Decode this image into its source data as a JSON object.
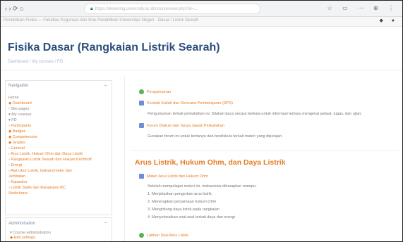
{
  "browser": {
    "nav_glyphs": "‹ › ⟳ ⌂",
    "url": "https://elearning.university.ac.id/course/view.php?id=...",
    "actions": "☆ ▭ ⋯ ⊕ ⋮"
  },
  "sitebar": {
    "crumb": "Pendidikan Fisika — Fakultas Keguruan dan Ilmu Pendidikan Universitas Negeri · Dasar / Listrik Searah",
    "user": "◆ ●"
  },
  "page": {
    "title": "Fisika Dasar (Rangkaian Listrik Searah)",
    "breadcrumb": "Dashboard / My courses / FD"
  },
  "sidebar": {
    "header": "Navigation",
    "collapse": "–",
    "items": [
      {
        "text": "Home",
        "orange": false
      },
      {
        "text": "◆ Dashboard",
        "orange": true
      },
      {
        "text": "› Site pages",
        "orange": false
      },
      {
        "text": "▾ My courses",
        "orange": false
      },
      {
        "text": "  ▾ FD",
        "orange": false
      },
      {
        "text": "    › Participants",
        "orange": true
      },
      {
        "text": "    ◆ Badges",
        "orange": true
      },
      {
        "text": "    ◆ Competencies",
        "orange": true
      },
      {
        "text": "    ◆ Grades",
        "orange": true
      },
      {
        "text": "    › General",
        "orange": true
      },
      {
        "text": "    › Arus Listrik, Hukum Ohm dan Daya Listrik",
        "orange": true
      },
      {
        "text": "    › Rangkaian Listrik Searah dan Hukum Kirchhoff",
        "orange": true
      },
      {
        "text": "    › Energi",
        "orange": true
      },
      {
        "text": "    › Alat Ukur Listrik, Galvanometer dan",
        "orange": true
      },
      {
        "text": "      Jembatan",
        "orange": true
      },
      {
        "text": "    › Kapasitor",
        "orange": true
      },
      {
        "text": "    › Listrik Statis dan Rangkaian RC",
        "orange": true
      },
      {
        "text": "      Sederhana",
        "orange": true
      }
    ]
  },
  "sidebar2": {
    "header": "Administration",
    "collapse": "–",
    "items": [
      "▾ Course administration",
      "  ◆ Edit settings"
    ]
  },
  "main": {
    "activities_top": [
      {
        "icon": "green",
        "text": "Pengumuman"
      },
      {
        "icon": "blue",
        "text": "Kontrak Kuliah dan Rencana Pembelajaran (RPS)"
      }
    ],
    "desc1": "Pengumuman terkait perkuliahan ini. Silakan baca secara berkala untuk informasi terbaru mengenai jadwal, tugas, dan ujian.",
    "activity3": "Forum Diskusi dan Tanya Jawab Perkuliahan",
    "desc2": "Gunakan forum ini untuk bertanya dan berdiskusi terkait materi yang dipelajari.",
    "section_title": "Arus Listrik, Hukum Ohm, dan Daya Listrik",
    "section_activity": "Materi Arus Listrik dan Hukum Ohm",
    "objectives_intro": "Setelah mempelajari materi ini, mahasiswa diharapkan mampu:",
    "objectives": [
      "1. Menjelaskan pengertian arus listrik",
      "2. Menerapkan persamaan hukum Ohm",
      "3. Menghitung daya listrik pada rangkaian",
      "4. Menyelesaikan soal-soal terkait daya dan energi"
    ],
    "bottom_activity": "Latihan Soal Arus Listrik"
  }
}
